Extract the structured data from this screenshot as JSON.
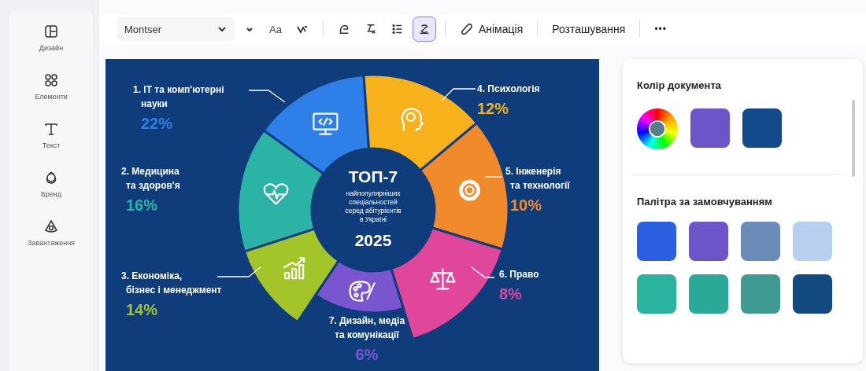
{
  "sidebar": {
    "items": [
      {
        "label": "Дизайн"
      },
      {
        "label": "Елементи"
      },
      {
        "label": "Текст"
      },
      {
        "label": "Бренд"
      },
      {
        "label": "Завантаження"
      }
    ]
  },
  "toolbar": {
    "font": "Montser",
    "case_label": "Aa",
    "tools": [
      {
        "selected": false
      },
      {
        "selected": false
      },
      {
        "selected": false
      },
      {
        "selected": true
      }
    ],
    "animation": "Анімація",
    "position": "Розташування",
    "more": "•••"
  },
  "infographic": {
    "title": "ТОП-7",
    "subtitle": [
      "найпопулярніших",
      "спеціальностей",
      "серед абітурієнтів",
      "в Україні"
    ],
    "year": "2025",
    "categories": [
      {
        "lines": [
          "1. IT та комп'ютерні",
          "науки"
        ],
        "percent": "22%",
        "color": "#2f7fe8"
      },
      {
        "lines": [
          "2. Медицина",
          "та здоров'я"
        ],
        "percent": "16%",
        "color": "#2bb3a6"
      },
      {
        "lines": [
          "3. Економіка,",
          "бізнес і менеджмент"
        ],
        "percent": "14%",
        "color": "#a4c52a"
      },
      {
        "lines": [
          "4. Психологія"
        ],
        "percent": "12%",
        "color": "#f7b21b"
      },
      {
        "lines": [
          "5. Інженерія",
          "та технології"
        ],
        "percent": "10%",
        "color": "#f08a2a"
      },
      {
        "lines": [
          "6. Право"
        ],
        "percent": "8%",
        "color": "#e0479a"
      },
      {
        "lines": [
          "7. Дизайн, медіа",
          "та комунікації"
        ],
        "percent": "6%",
        "color": "#7a55d0"
      }
    ]
  },
  "panel": {
    "document_title": "Колір документа",
    "document_colors": [
      {
        "color": "#6b55c9"
      },
      {
        "color": "#124a8c"
      }
    ],
    "palette_title": "Палітра за замовчуванням",
    "palette": [
      {
        "color": "#2b5fe0"
      },
      {
        "color": "#6c54c9"
      },
      {
        "color": "#6b8bb8"
      },
      {
        "color": "#b8d0ef"
      },
      {
        "color": "#2bb3a0"
      },
      {
        "color": "#2aa898"
      },
      {
        "color": "#3f9a92"
      },
      {
        "color": "#12497f"
      }
    ]
  }
}
